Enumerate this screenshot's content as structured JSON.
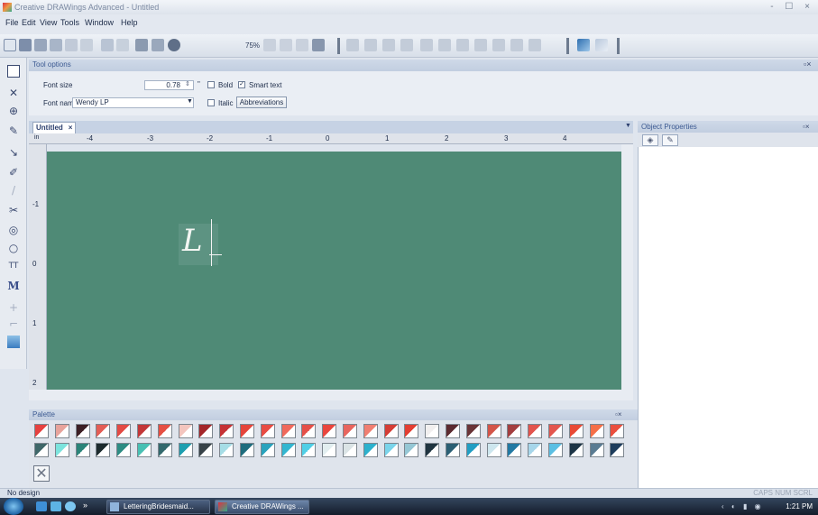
{
  "window": {
    "title": "Creative DRAWings Advanced - Untitled",
    "controls": "- ☐ ×"
  },
  "menu": [
    "File",
    "Edit",
    "View",
    "Tools",
    "Window",
    "Help"
  ],
  "toolbar": {
    "zoom": "75%"
  },
  "tool_options": {
    "header": "Tool options",
    "font_size_label": "Font size",
    "font_size_value": "0.78",
    "font_size_unit": "\"",
    "font_name_label": "Font name",
    "font_name_value": "Wendy LP",
    "bold_label": "Bold",
    "bold_checked": false,
    "italic_label": "Italic",
    "italic_checked": false,
    "smart_text_label": "Smart text",
    "smart_text_checked": true,
    "abbreviations_label": "Abbreviations"
  },
  "document": {
    "tab_label": "Untitled",
    "ruler_unit": "in",
    "h_ruler_labels": [
      "-4",
      "-3",
      "-2",
      "-1",
      "0",
      "1",
      "2",
      "3",
      "4"
    ],
    "v_ruler_labels": [
      "-1",
      "0",
      "1",
      "2"
    ],
    "canvas_color": "#4f8a76",
    "text_content": "L"
  },
  "palette": {
    "header": "Palette",
    "row1": [
      "#e6413f",
      "#e7a39b",
      "#3d1f24",
      "#e35d55",
      "#e34a44",
      "#c33738",
      "#e54f43",
      "#f3c5be",
      "#a32629",
      "#c53235",
      "#e5453b",
      "#e84c43",
      "#f0695c",
      "#e55049",
      "#e9453d",
      "#e8655e",
      "#f07e71",
      "#d53d35",
      "#e33e32",
      "#f1efef",
      "#5c2a30",
      "#6a3437",
      "#d35549",
      "#a33e3f",
      "#e2544d",
      "#e3564e",
      "#e84935",
      "#f56f48",
      "#ea4f3e"
    ],
    "row2": [
      "#3f6769",
      "#7be3dd",
      "#2b8479",
      "#1d2b2e",
      "#2d8c83",
      "#48c0b3",
      "#33696d",
      "#1e9fb0",
      "#364147",
      "#a6dde6",
      "#1e6c7d",
      "#2aa3bd",
      "#33b6d0",
      "#50cfe6",
      "#e2eef0",
      "#dbe4e6",
      "#2cb1cd",
      "#7ad4ea",
      "#95c7d5",
      "#1f3440",
      "#2a5f74",
      "#229ec3",
      "#cde6ee",
      "#2279a3",
      "#a7d6ea",
      "#5bbfe3",
      "#1c3446",
      "#5a7b92",
      "#1d3c5c"
    ]
  },
  "object_properties": {
    "header": "Object Properties"
  },
  "status": {
    "left": "No design",
    "right": "CAPS NUM SCRL"
  },
  "taskbar": {
    "tasks": [
      "LetteringBridesmaid...",
      "Creative DRAWings ..."
    ],
    "clock": "1:21 PM",
    "quicklaunch_overflow": "»"
  }
}
